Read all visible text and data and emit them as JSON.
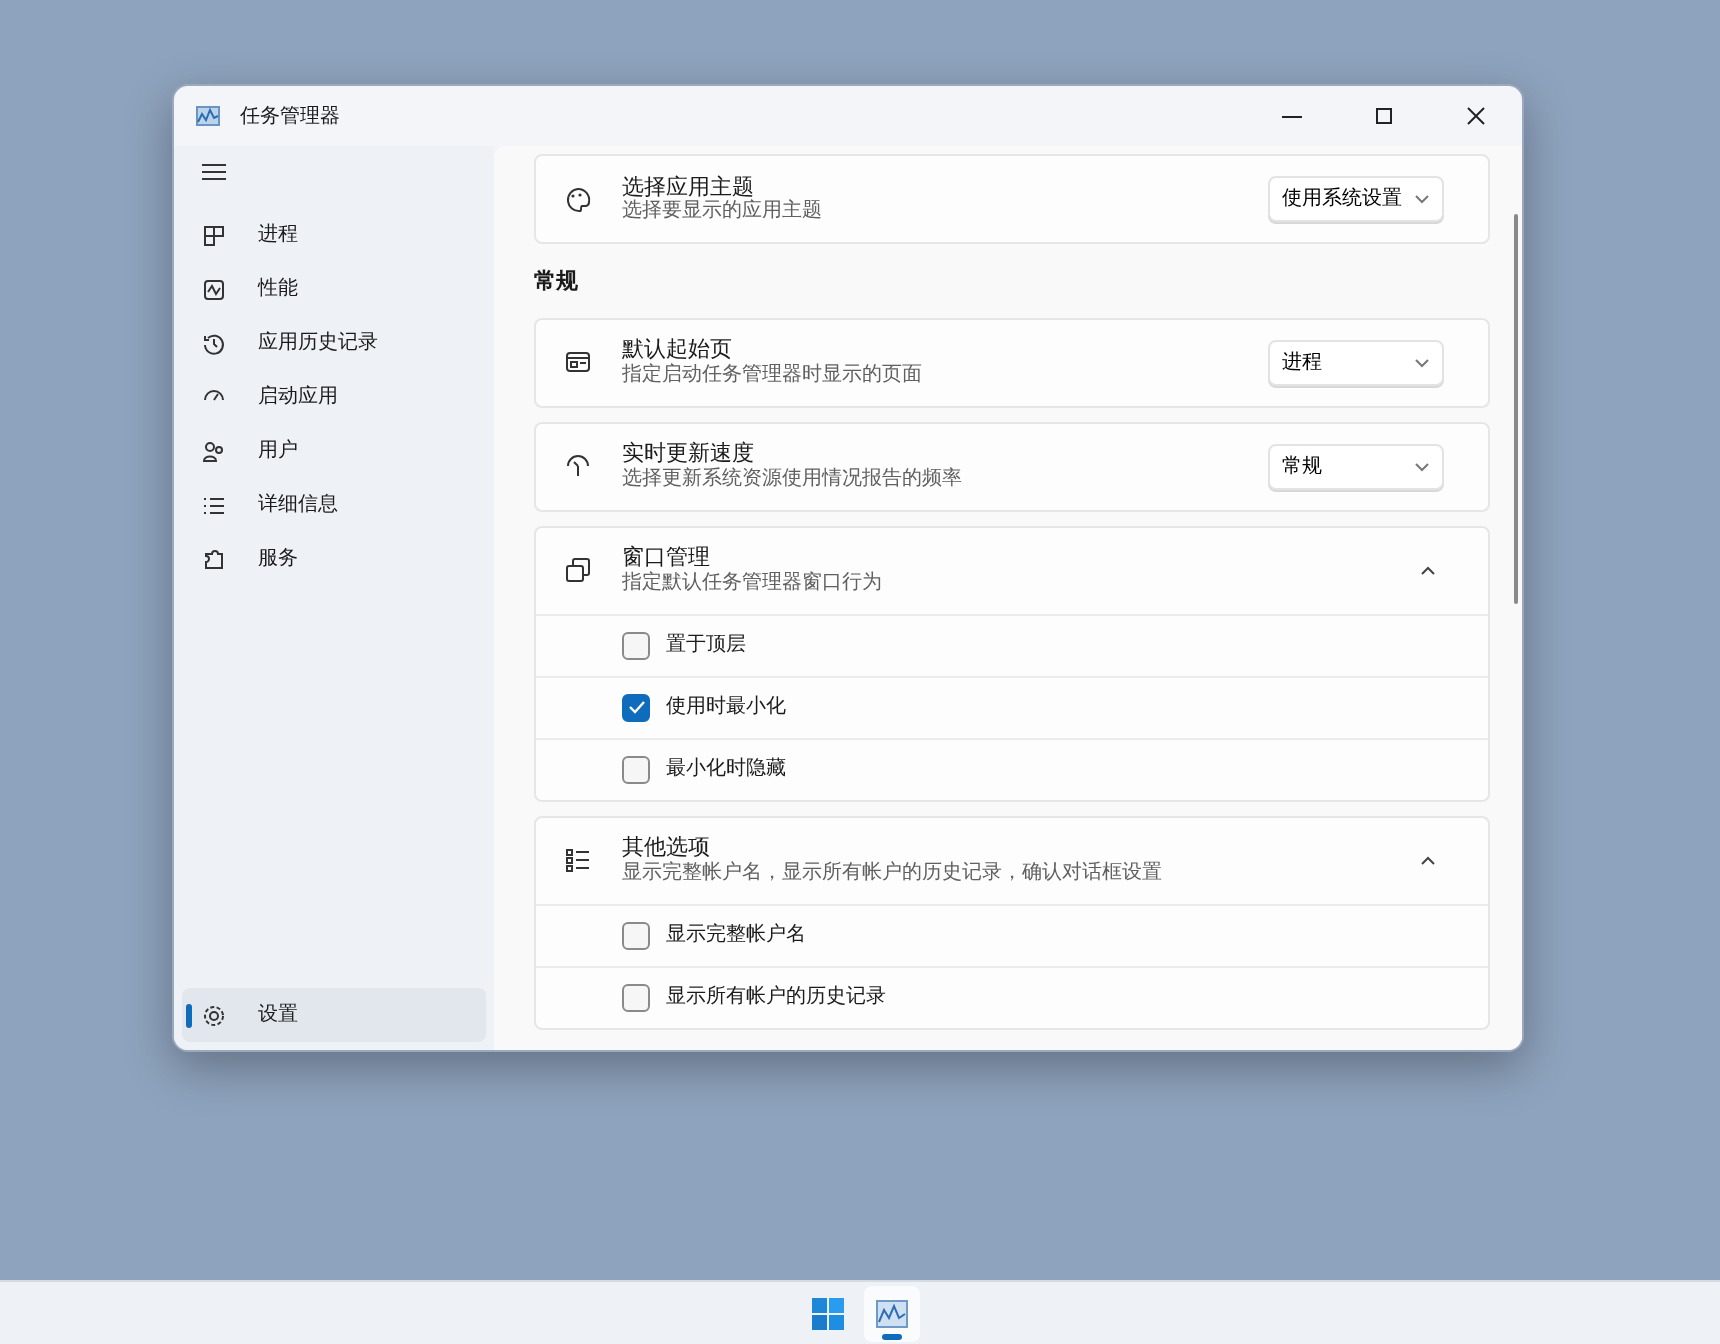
{
  "window": {
    "title": "任务管理器"
  },
  "sidebar": {
    "items": [
      {
        "label": "进程",
        "selected": false
      },
      {
        "label": "性能",
        "selected": false
      },
      {
        "label": "应用历史记录",
        "selected": false
      },
      {
        "label": "启动应用",
        "selected": false
      },
      {
        "label": "用户",
        "selected": false
      },
      {
        "label": "详细信息",
        "selected": false
      },
      {
        "label": "服务",
        "selected": false
      }
    ],
    "settings_item": {
      "label": "设置",
      "selected": true
    }
  },
  "content": [
    {
      "kind": "dropdown",
      "title": "选择应用主题",
      "description": "选择要显示的应用主题",
      "value": "使用系统设置"
    },
    {
      "kind": "heading",
      "text": "常规"
    },
    {
      "kind": "dropdown",
      "title": "默认起始页",
      "description": "指定启动任务管理器时显示的页面",
      "value": "进程"
    },
    {
      "kind": "dropdown",
      "title": "实时更新速度",
      "description": "选择更新系统资源使用情况报告的频率",
      "value": "常规"
    },
    {
      "kind": "expander",
      "title": "窗口管理",
      "description": "指定默认任务管理器窗口行为",
      "expanded": true,
      "options": [
        {
          "label": "置于顶层",
          "checked": false
        },
        {
          "label": "使用时最小化",
          "checked": true
        },
        {
          "label": "最小化时隐藏",
          "checked": false
        }
      ]
    },
    {
      "kind": "expander",
      "title": "其他选项",
      "description": "显示完整帐户名，显示所有帐户的历史记录，确认对话框设置",
      "expanded": true,
      "options": [
        {
          "label": "显示完整帐户名",
          "checked": false
        },
        {
          "label": "显示所有帐户的历史记录",
          "checked": false
        }
      ]
    }
  ],
  "taskbar": {
    "items": [
      {
        "kind": "start",
        "selected": false
      },
      {
        "kind": "app",
        "selected": true
      }
    ]
  }
}
